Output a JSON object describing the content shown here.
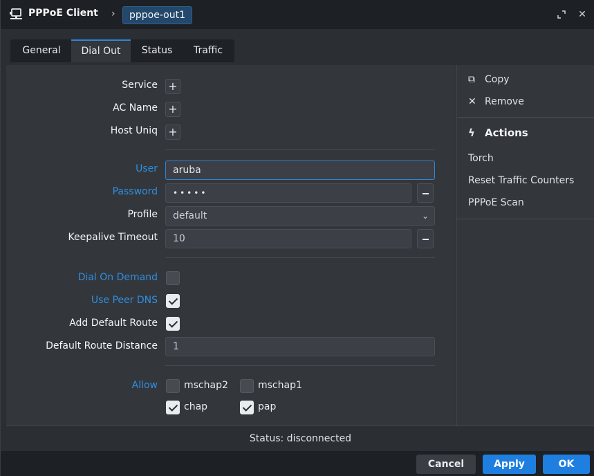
{
  "window": {
    "title": "PPPoE Client",
    "breadcrumb_sep": "›",
    "item_name": "pppoe-out1",
    "restore_icon": "restore-icon",
    "close_glyph": "✕"
  },
  "tabs": [
    {
      "label": "General"
    },
    {
      "label": "Dial Out",
      "active": true
    },
    {
      "label": "Status"
    },
    {
      "label": "Traffic"
    }
  ],
  "form": {
    "service_label": "Service",
    "ac_name_label": "AC Name",
    "host_uniq_label": "Host Uniq",
    "plus_glyph": "+",
    "user_label": "User",
    "user_value": "aruba",
    "password_label": "Password",
    "password_value": "•••••",
    "profile_label": "Profile",
    "profile_value": "default",
    "keepalive_label": "Keepalive Timeout",
    "keepalive_value": "10",
    "dial_on_demand_label": "Dial On Demand",
    "dial_on_demand_checked": false,
    "use_peer_dns_label": "Use Peer DNS",
    "use_peer_dns_checked": true,
    "add_default_route_label": "Add Default Route",
    "add_default_route_checked": true,
    "default_route_distance_label": "Default Route Distance",
    "default_route_distance_value": "1",
    "allow_label": "Allow",
    "allow_options": [
      {
        "label": "mschap2",
        "checked": false
      },
      {
        "label": "mschap1",
        "checked": false
      },
      {
        "label": "chap",
        "checked": true
      },
      {
        "label": "pap",
        "checked": true
      }
    ]
  },
  "sidebar": {
    "copy_label": "Copy",
    "remove_label": "Remove",
    "actions_heading": "Actions",
    "actions": [
      {
        "label": "Torch"
      },
      {
        "label": "Reset Traffic Counters"
      },
      {
        "label": "PPPoE Scan"
      }
    ]
  },
  "status": {
    "text": "Status: disconnected"
  },
  "buttons": {
    "cancel": "Cancel",
    "apply": "Apply",
    "ok": "OK"
  },
  "colors": {
    "accent": "#1f7fe0",
    "label_blue": "#2f8ee0",
    "panel": "#33373c",
    "titlebar": "#1d2024"
  }
}
